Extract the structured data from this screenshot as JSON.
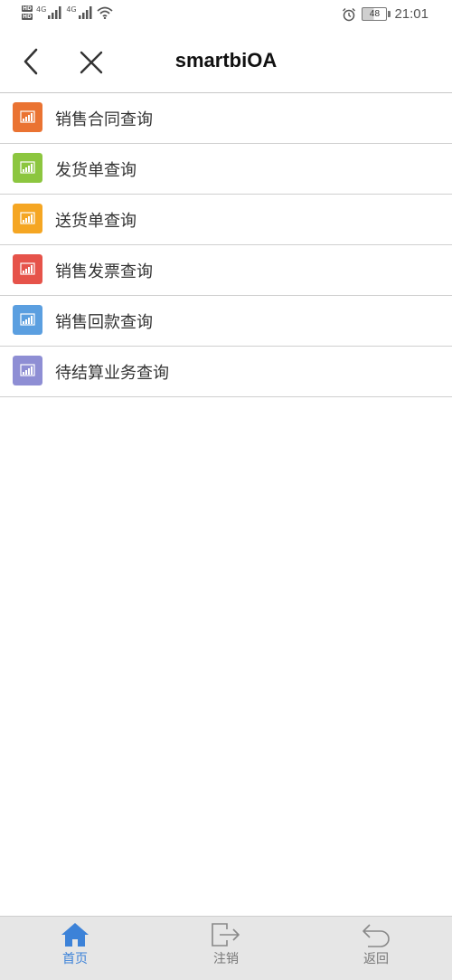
{
  "status_bar": {
    "hd1": "HD",
    "hd2": "HD",
    "net1": "4G",
    "net2": "4G",
    "battery_level": "48",
    "time": "21:01",
    "icons": [
      "signal-icon",
      "wifi-icon",
      "alarm-icon",
      "battery-icon"
    ]
  },
  "nav": {
    "title": "smartbiOA",
    "back_icon": "chevron-left-icon",
    "close_icon": "close-icon"
  },
  "menu": {
    "items": [
      {
        "label": "销售合同查询",
        "color": "#ea7332"
      },
      {
        "label": "发货单查询",
        "color": "#8cc63f"
      },
      {
        "label": "送货单查询",
        "color": "#f5a623"
      },
      {
        "label": "销售发票查询",
        "color": "#e6534a"
      },
      {
        "label": "销售回款查询",
        "color": "#5b9fe0"
      },
      {
        "label": "待结算业务查询",
        "color": "#8e8ed4"
      }
    ],
    "icon_name": "chart-icon"
  },
  "tab_bar": {
    "tabs": [
      {
        "label": "首页",
        "icon": "home-icon",
        "active": true
      },
      {
        "label": "注销",
        "icon": "logout-icon",
        "active": false
      },
      {
        "label": "返回",
        "icon": "return-icon",
        "active": false
      }
    ],
    "active_color": "#3c82d8",
    "inactive_color": "#888888"
  }
}
